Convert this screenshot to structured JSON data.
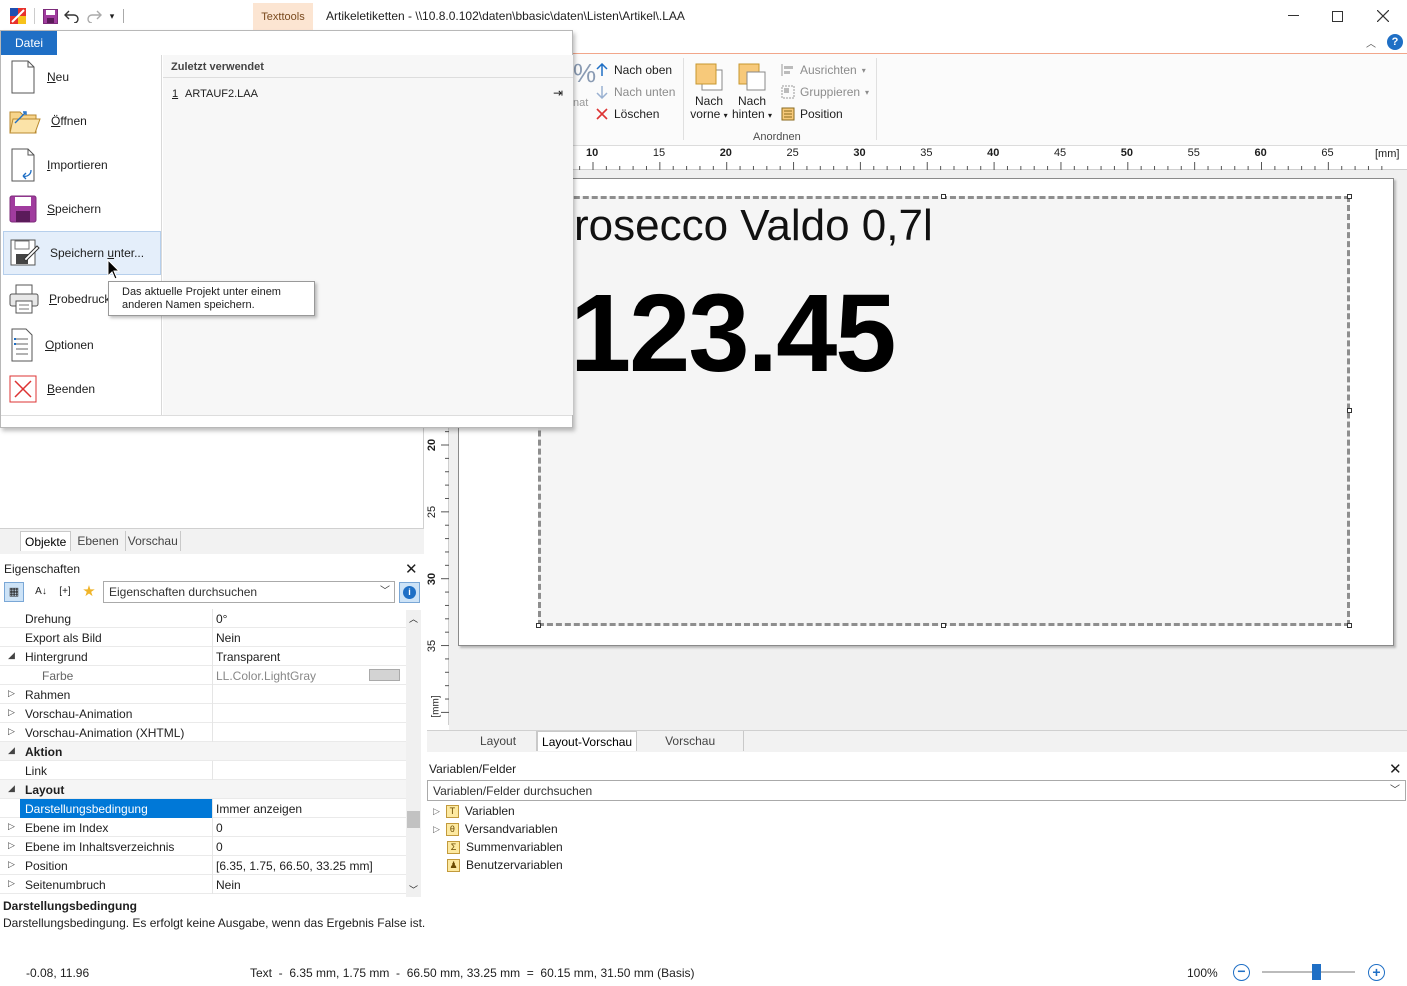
{
  "window": {
    "title": "Artikeletiketten - \\\\10.8.0.102\\daten\\bbasic\\daten\\Listen\\Artikel\\.LAA",
    "context_tab": "Texttools"
  },
  "ribbon": {
    "nach_oben": "Nach oben",
    "nach_unten": "Nach unten",
    "loeschen": "Löschen",
    "nach_vorne_1": "Nach",
    "nach_vorne_2": "vorne",
    "nach_hinten_1": "Nach",
    "nach_hinten_2": "hinten",
    "ausrichten": "Ausrichten",
    "gruppieren": "Gruppieren",
    "position": "Position",
    "group_anordnen": "Anordnen",
    "partial_label": "nat"
  },
  "ruler": {
    "unit": "[mm]",
    "h_ticks": [
      "10",
      "15",
      "20",
      "25",
      "30",
      "35",
      "40",
      "45",
      "50",
      "55",
      "60",
      "65"
    ],
    "v_ticks": [
      "20",
      "25",
      "30",
      "35"
    ]
  },
  "label": {
    "text": "rosecco Valdo 0,7l",
    "price": "123.45"
  },
  "center_tabs": [
    "Layout",
    "Layout-Vorschau",
    "Vorschau"
  ],
  "left_tabs": [
    "Objekte",
    "Ebenen",
    "Vorschau"
  ],
  "properties": {
    "header": "Eigenschaften",
    "search_placeholder": "Eigenschaften durchsuchen",
    "rows": [
      {
        "name": "Drehung",
        "value": "0°",
        "exp": ""
      },
      {
        "name": "Export als Bild",
        "value": "Nein",
        "exp": ""
      },
      {
        "name": "Hintergrund",
        "value": "Transparent",
        "exp": "◢"
      },
      {
        "name": "Farbe",
        "value": "LL.Color.LightGray",
        "exp": ""
      },
      {
        "name": "Rahmen",
        "value": "",
        "exp": "▷"
      },
      {
        "name": "Vorschau-Animation",
        "value": "",
        "exp": "▷"
      },
      {
        "name": "Vorschau-Animation (XHTML)",
        "value": "",
        "exp": "▷"
      },
      {
        "name": "Aktion",
        "value": "",
        "exp": "◢"
      },
      {
        "name": "Link",
        "value": "",
        "exp": ""
      },
      {
        "name": "Layout",
        "value": "",
        "exp": "◢"
      },
      {
        "name": "Darstellungsbedingung",
        "value": "Immer anzeigen",
        "exp": ""
      },
      {
        "name": "Ebene im Index",
        "value": "0",
        "exp": "▷"
      },
      {
        "name": "Ebene im Inhaltsverzeichnis",
        "value": "0",
        "exp": "▷"
      },
      {
        "name": "Position",
        "value": "[6.35, 1.75, 66.50, 33.25 mm]",
        "exp": "▷"
      },
      {
        "name": "Seitenumbruch",
        "value": "Nein",
        "exp": "▷"
      }
    ],
    "desc_title": "Darstellungsbedingung",
    "desc_text": "Darstellungsbedingung. Es erfolgt keine Ausgabe, wenn das Ergebnis False ist."
  },
  "variables": {
    "header": "Variablen/Felder",
    "search_placeholder": "Variablen/Felder durchsuchen",
    "items": [
      {
        "label": "Variablen",
        "icon": "T"
      },
      {
        "label": "Versandvariablen",
        "icon": "θ"
      },
      {
        "label": "Summenvariablen",
        "icon": "Σ"
      },
      {
        "label": "Benutzervariablen",
        "icon": "♟"
      }
    ]
  },
  "status": {
    "coords": "-0.08, 11.96",
    "info": "Text  -  6.35 mm, 1.75 mm  -  66.50 mm, 33.25 mm  =  60.15 mm, 31.50 mm (Basis)",
    "zoom": "100%",
    "zoom_level": 0.6
  },
  "backstage": {
    "tab": "Datei",
    "recent_header": "Zuletzt verwendet",
    "recent": [
      {
        "num": "1",
        "name": "ARTAUF2.LAA"
      }
    ],
    "items": [
      {
        "label": "Neu",
        "icon": "new-document-icon"
      },
      {
        "label": "Öffnen",
        "icon": "open-folder-icon"
      },
      {
        "label": "Importieren",
        "icon": "import-icon"
      },
      {
        "label": "Speichern",
        "icon": "save-icon"
      },
      {
        "label": "Speichern unter...",
        "icon": "save-as-icon"
      },
      {
        "label": "Probedruck",
        "icon": "printer-icon"
      },
      {
        "label": "Optionen",
        "icon": "options-icon"
      },
      {
        "label": "Beenden",
        "icon": "exit-icon"
      }
    ],
    "tooltip": "Das aktuelle Projekt unter einem anderen Namen speichern."
  },
  "colors": {
    "accent": "#1f6fc5",
    "selection": "#0078d7",
    "context_tab": "#fce5d2"
  }
}
